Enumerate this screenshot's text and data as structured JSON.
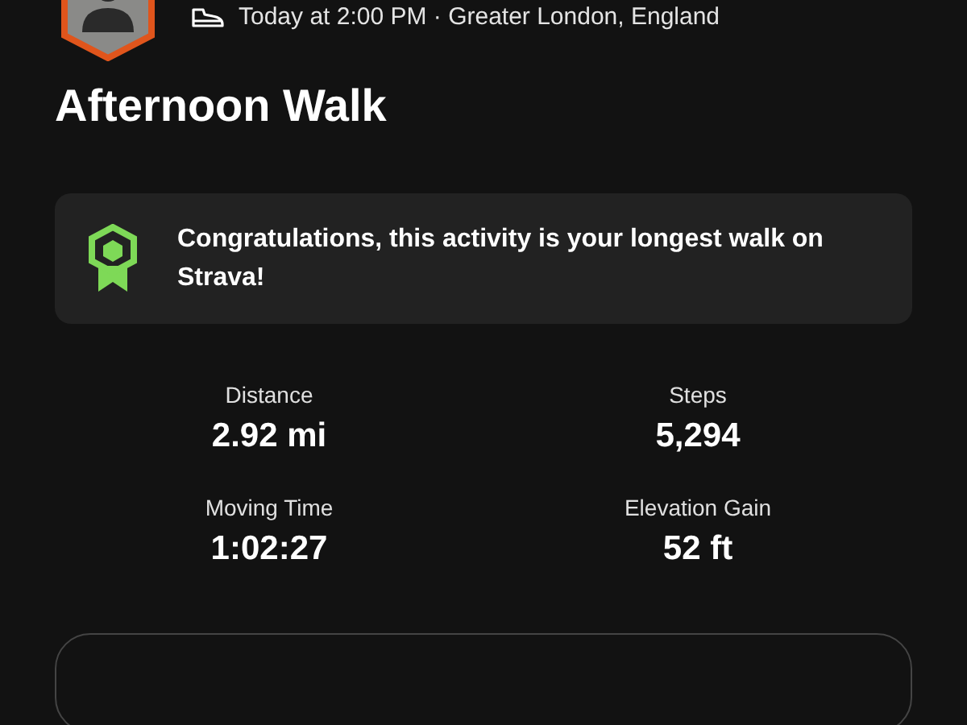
{
  "header": {
    "meta": "Today at 2:00 PM · Greater London, England"
  },
  "title": "Afternoon Walk",
  "achievement": {
    "text": "Congratulations, this activity is your longest walk on Strava!"
  },
  "stats": [
    {
      "label": "Distance",
      "value": "2.92 mi"
    },
    {
      "label": "Steps",
      "value": "5,294"
    },
    {
      "label": "Moving Time",
      "value": "1:02:27"
    },
    {
      "label": "Elevation Gain",
      "value": "52 ft"
    }
  ]
}
